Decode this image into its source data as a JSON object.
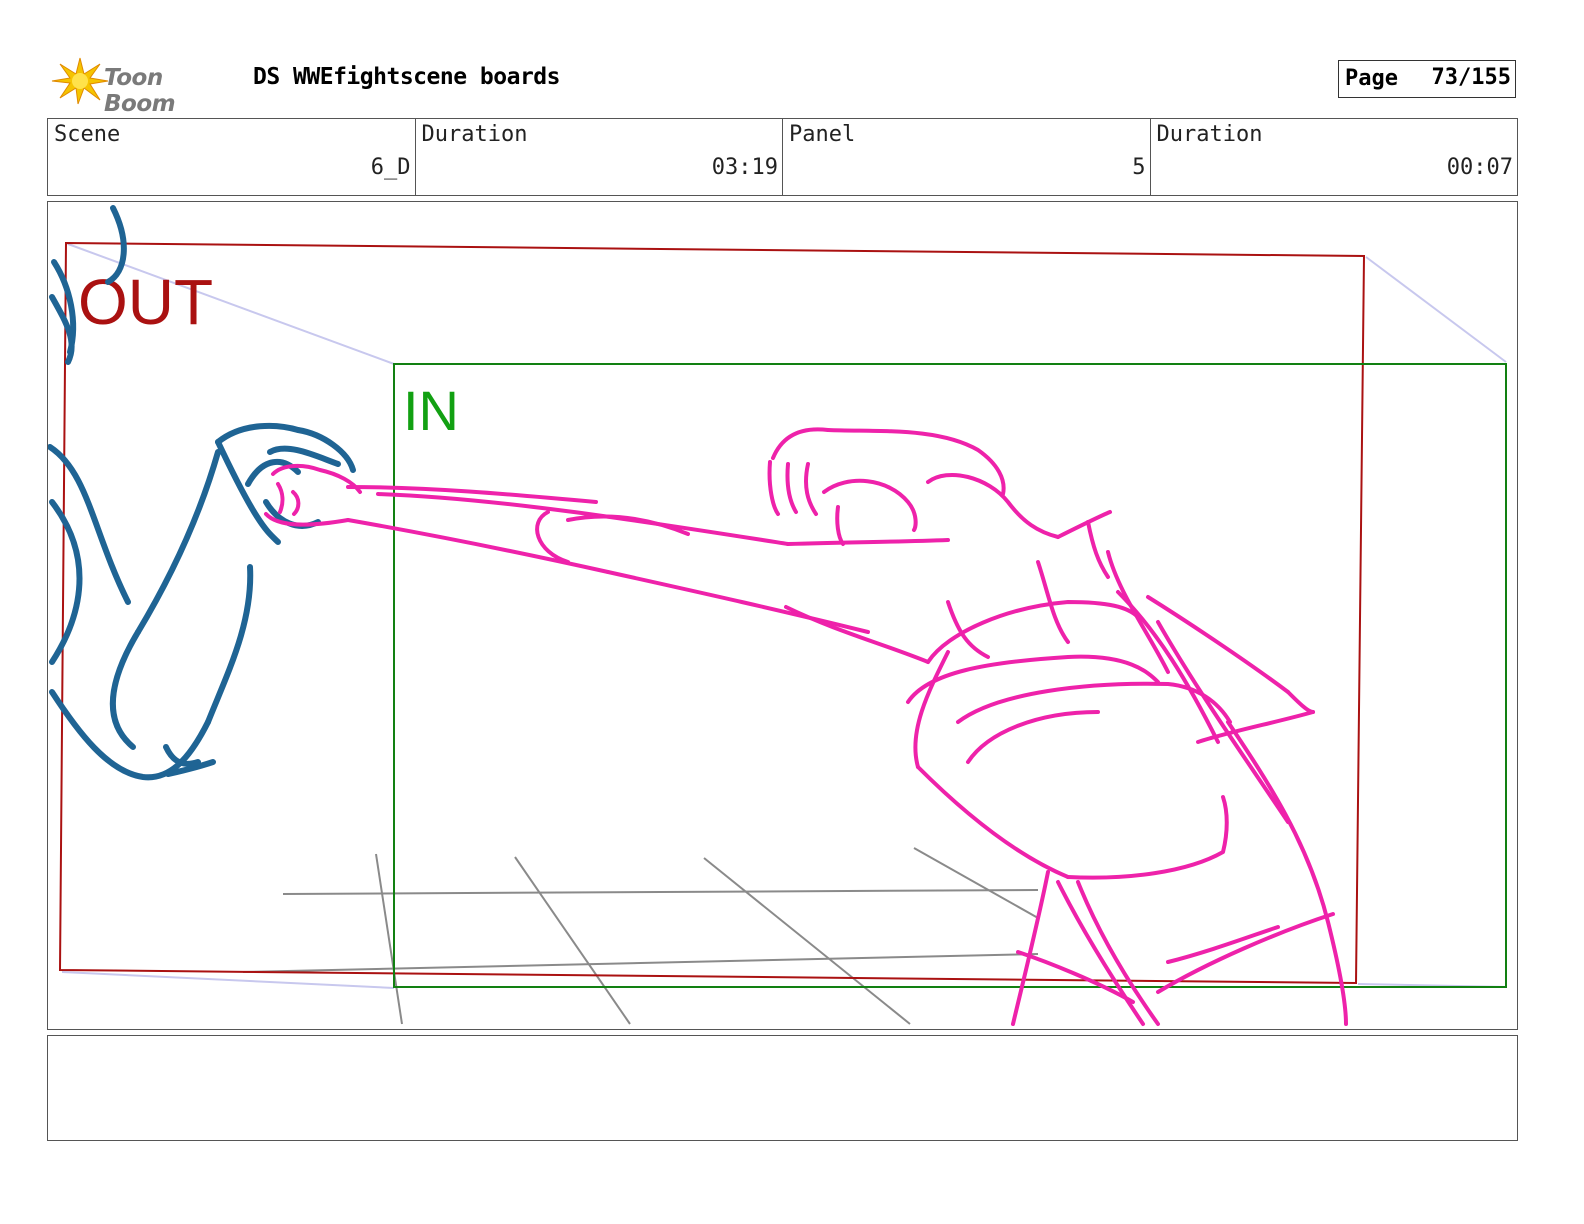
{
  "header": {
    "logo_text": "Toon Boom",
    "title": "DS WWEfightscene boards",
    "page_label": "Page",
    "page_number": "73/155"
  },
  "info": [
    {
      "label": "Scene",
      "value": "6_D"
    },
    {
      "label": "Duration",
      "value": "03:19"
    },
    {
      "label": "Panel",
      "value": "5"
    },
    {
      "label": "Duration",
      "value": "00:07"
    }
  ],
  "panel": {
    "frame_out_label": "OUT",
    "frame_in_label": "IN"
  },
  "notes": {
    "text": ""
  },
  "colors": {
    "out_frame": "#aa1111",
    "in_frame": "#128012",
    "character_pink": "#ee22aa",
    "character_blue": "#1f6494",
    "guide_lines": "#8a8a8a",
    "camera_path": "#c8c8ee",
    "logo_star": "#f5c400"
  }
}
